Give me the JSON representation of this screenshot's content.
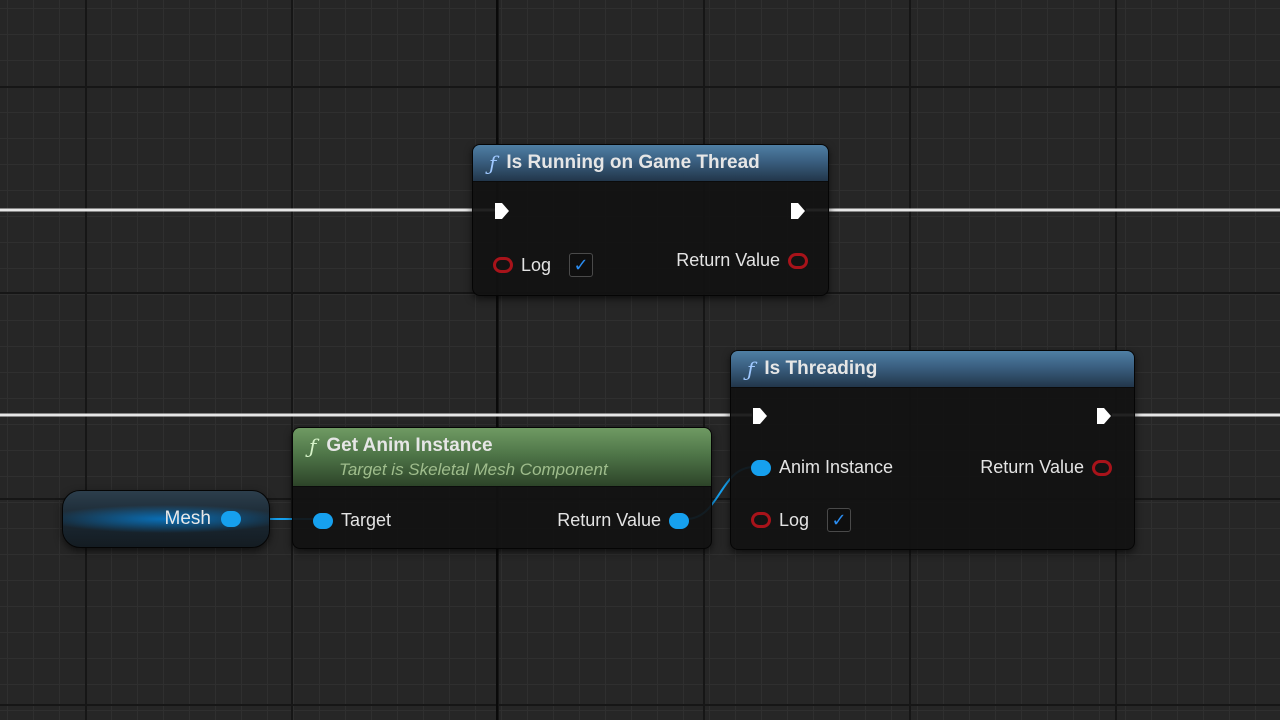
{
  "nodes": {
    "game_thread": {
      "title": "Is Running on Game Thread",
      "func_icon": "ƒ",
      "log_label": "Log",
      "log_checked": true,
      "return_label": "Return Value"
    },
    "is_threading": {
      "title": "Is Threading",
      "func_icon": "ƒ",
      "anim_label": "Anim Instance",
      "return_label": "Return Value",
      "log_label": "Log",
      "log_checked": true
    },
    "get_anim_instance": {
      "title": "Get Anim Instance",
      "subtitle": "Target is Skeletal Mesh Component",
      "func_icon": "ƒ",
      "target_label": "Target",
      "return_label": "Return Value"
    },
    "mesh": {
      "label": "Mesh"
    }
  },
  "check_glyph": "✓",
  "colors": {
    "object_pin": "#16a0ee",
    "bool_pin": "#a8131a",
    "exec_wire": "#e6e6e6",
    "function_header": "#3a5f80",
    "pure_function_header": "#4f7648"
  },
  "icons": {
    "function": "function-f-icon",
    "exec": "exec-pin-icon",
    "object": "object-pin-icon",
    "bool": "bool-pin-icon",
    "checkbox": "checkmark-icon"
  }
}
